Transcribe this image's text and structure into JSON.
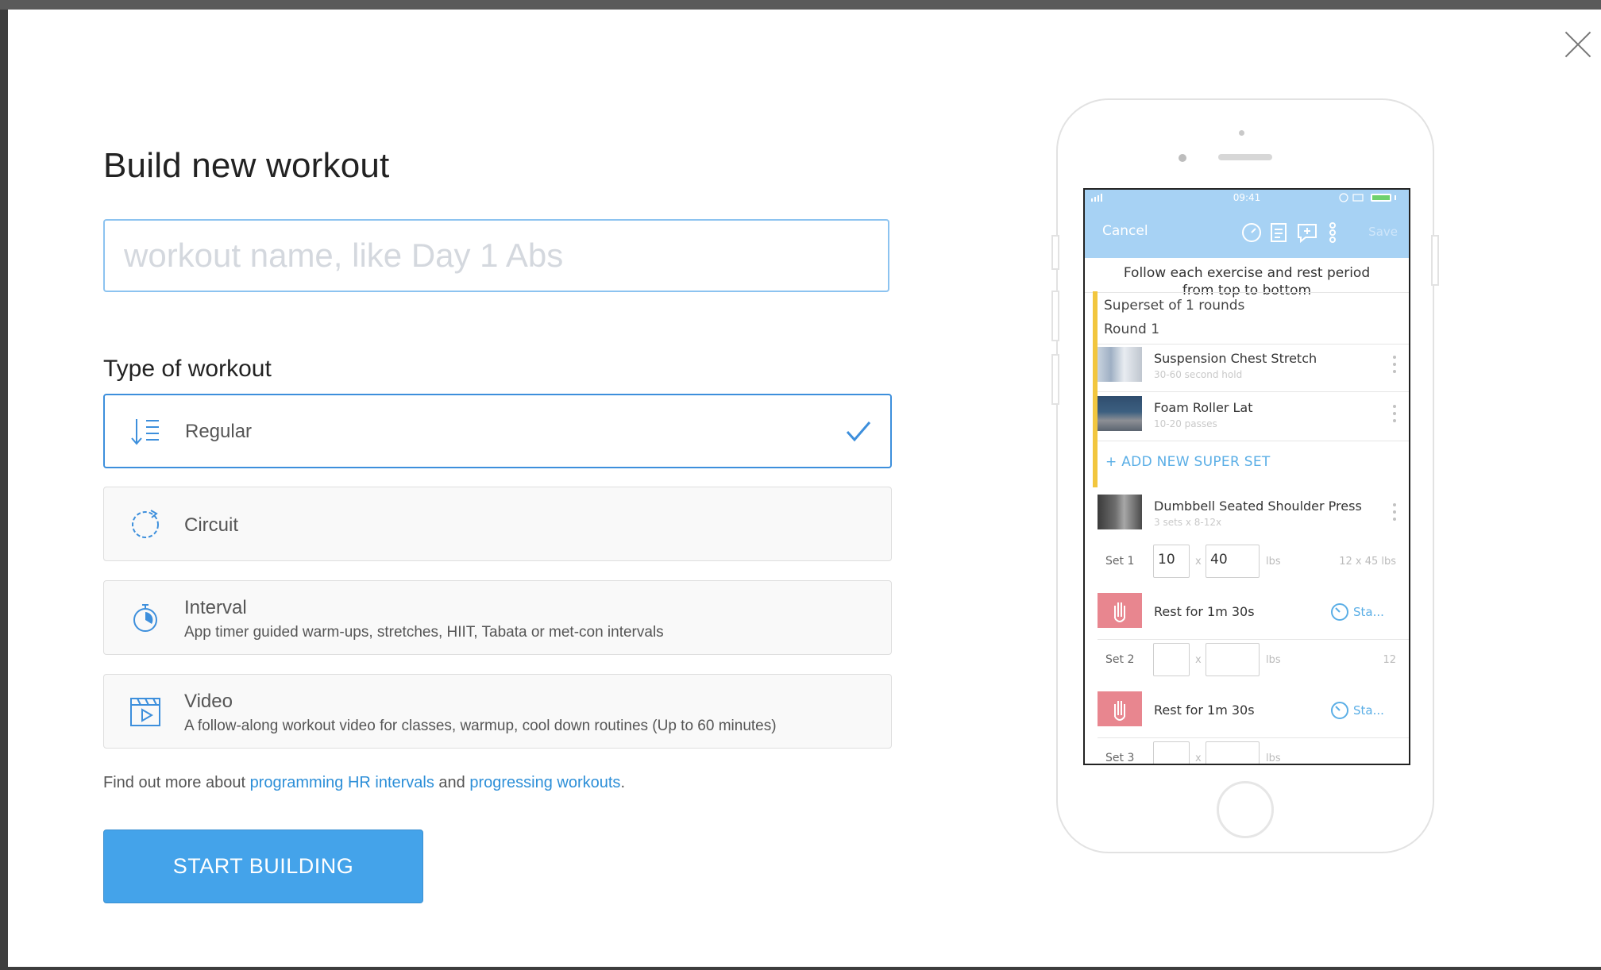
{
  "modal": {
    "title": "Build new workout",
    "name_placeholder": "workout name, like Day 1 Abs",
    "type_heading": "Type of workout",
    "options": [
      {
        "title": "Regular",
        "description": "",
        "icon": "list-sort-icon",
        "selected": true
      },
      {
        "title": "Circuit",
        "description": "",
        "icon": "circuit-refresh-icon",
        "selected": false
      },
      {
        "title": "Interval",
        "description": "App timer guided warm-ups, stretches, HIIT, Tabata or met-con intervals",
        "icon": "stopwatch-icon",
        "selected": false
      },
      {
        "title": "Video",
        "description": "A follow-along workout video for classes, warmup, cool down routines (Up to 60 minutes)",
        "icon": "video-clapper-icon",
        "selected": false
      }
    ],
    "info": {
      "prefix": "Find out more about ",
      "link1": "programming HR intervals",
      "middle": " and ",
      "link2": "progressing workouts",
      "suffix": "."
    },
    "start_button": "START BUILDING",
    "accent_color": "#44a3ea"
  },
  "phone": {
    "status_time": "09:41",
    "cancel": "Cancel",
    "save": "Save",
    "hint_line1": "Follow each exercise and rest period",
    "hint_line2": "from top to bottom",
    "superset_title": "Superset of 1 rounds",
    "round": "Round 1",
    "exercises": [
      {
        "name": "Suspension Chest Stretch",
        "sub": "30-60 second hold"
      },
      {
        "name": "Foam Roller Lat",
        "sub": "10-20 passes"
      },
      {
        "name": "Dumbbell Seated Shoulder Press",
        "sub": "3 sets x 8-12x"
      }
    ],
    "add_super": "+ ADD NEW SUPER SET",
    "sets": [
      {
        "label": "Set 1",
        "reps": "10",
        "weight": "40",
        "unit": "lbs",
        "prev": "12 x 45 lbs"
      },
      {
        "label": "Set 2",
        "reps": "",
        "weight": "",
        "unit": "lbs",
        "prev": "12"
      },
      {
        "label": "Set 3",
        "reps": "",
        "weight": "",
        "unit": "lbs",
        "prev": ""
      }
    ],
    "x": "x",
    "rest_label": "Rest for 1m 30s",
    "rest_start": "Sta...",
    "superset_color": "#f2c63e",
    "header_color": "#a7d2f4"
  }
}
